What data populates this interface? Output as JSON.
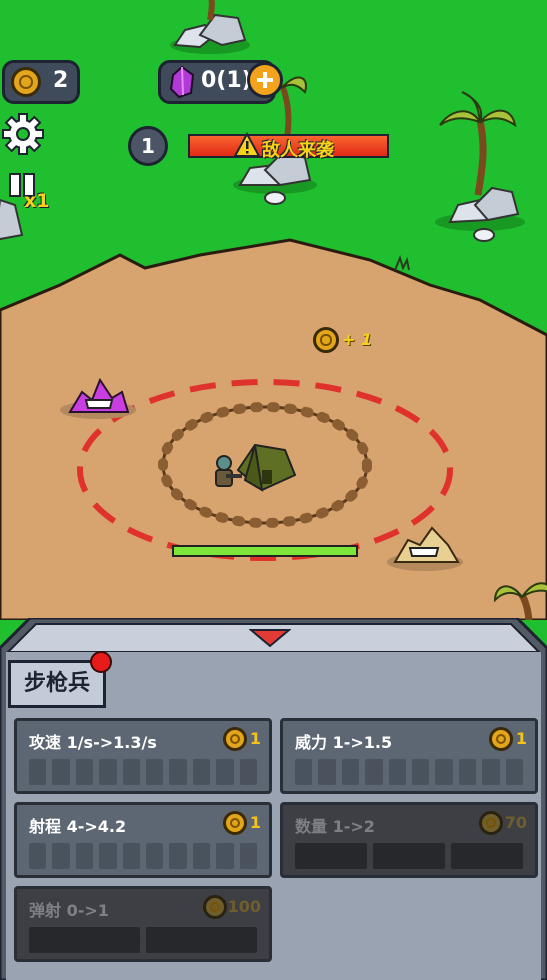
{
  "hud": {
    "coins": "2",
    "gems": "0(1)",
    "wave": "1",
    "alert": "敌人来袭",
    "speed": "x1",
    "pickup": "+ 1"
  },
  "panel": {
    "unit_tab": "步枪兵",
    "upgrades": [
      {
        "title": "攻速 1/s->1.3/s",
        "cost": "1",
        "segments": 10,
        "enabled": true
      },
      {
        "title": "威力 1->1.5",
        "cost": "1",
        "segments": 10,
        "enabled": true
      },
      {
        "title": "射程 4->4.2",
        "cost": "1",
        "segments": 10,
        "enabled": true
      },
      {
        "title": "数量 1->2",
        "cost": "70",
        "segments": 3,
        "enabled": false
      },
      {
        "title": "弹射 0->1",
        "cost": "100",
        "segments": 2,
        "enabled": false
      }
    ]
  },
  "base": {
    "health_fraction": 1.0
  },
  "colors": {
    "grass": "#1fbf2f",
    "sand": "#d7a36e",
    "alert_bar": "#f53c1f",
    "coin": "#e3a519",
    "panel": "#9aa3b2"
  }
}
